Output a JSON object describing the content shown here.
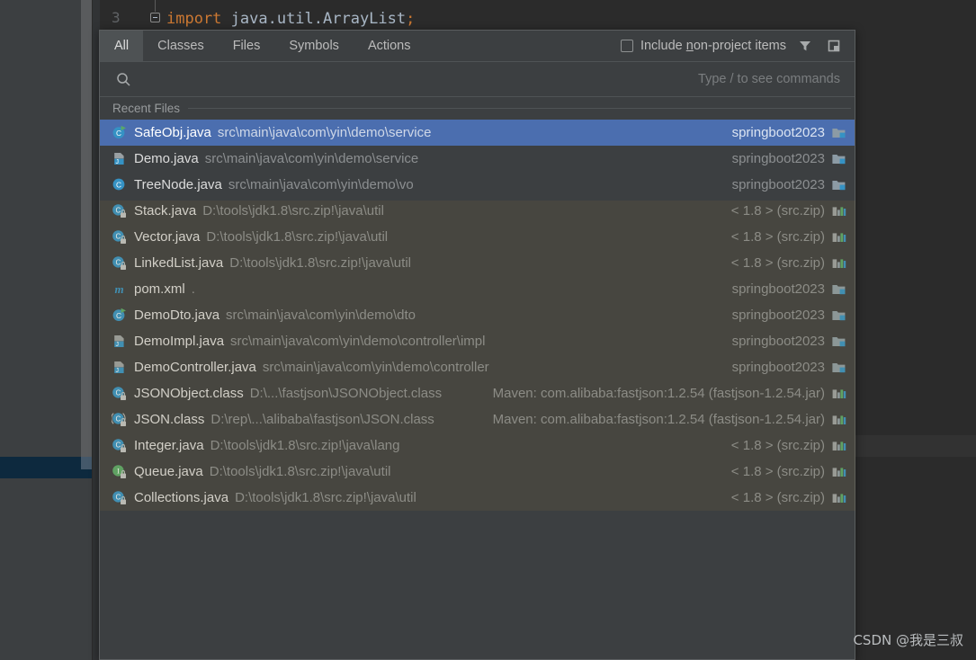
{
  "editor": {
    "line_number": "3",
    "keyword": "import",
    "expression": " java.util.ArrayList",
    "terminator": ";"
  },
  "popup": {
    "tabs": [
      {
        "label": "All",
        "active": true
      },
      {
        "label": "Classes",
        "active": false
      },
      {
        "label": "Files",
        "active": false
      },
      {
        "label": "Symbols",
        "active": false
      },
      {
        "label": "Actions",
        "active": false
      }
    ],
    "include_non_project": {
      "checked": false,
      "label_before": "Include ",
      "label_mnemonic": "n",
      "label_after": "on-project items"
    },
    "toolbar_icons": [
      {
        "name": "filter-icon"
      },
      {
        "name": "open-in-panel-icon"
      }
    ],
    "search": {
      "value": "",
      "placeholder": "",
      "hint": "Type / to see commands"
    },
    "group_header": "Recent Files",
    "rows": [
      {
        "icon": "java-class-runnable-icon",
        "name": "SafeObj.java",
        "path": "src\\main\\java\\com\\yin\\demo\\service",
        "module": "springboot2023",
        "module_icon": "module-folder-icon",
        "selected": true
      },
      {
        "icon": "java-file-icon",
        "name": "Demo.java",
        "path": "src\\main\\java\\com\\yin\\demo\\service",
        "module": "springboot2023",
        "module_icon": "module-folder-icon",
        "selected": false
      },
      {
        "icon": "java-class-icon",
        "name": "TreeNode.java",
        "path": "src\\main\\java\\com\\yin\\demo\\vo",
        "module": "springboot2023",
        "module_icon": "module-folder-icon",
        "selected": false
      },
      {
        "icon": "java-class-locked-icon",
        "name": "Stack.java",
        "path": "D:\\tools\\jdk1.8\\src.zip!\\java\\util",
        "module": "< 1.8 > (src.zip)",
        "module_icon": "library-icon",
        "selected": false
      },
      {
        "icon": "java-class-locked-icon",
        "name": "Vector.java",
        "path": "D:\\tools\\jdk1.8\\src.zip!\\java\\util",
        "module": "< 1.8 > (src.zip)",
        "module_icon": "library-icon",
        "selected": false
      },
      {
        "icon": "java-class-locked-icon",
        "name": "LinkedList.java",
        "path": "D:\\tools\\jdk1.8\\src.zip!\\java\\util",
        "module": "< 1.8 > (src.zip)",
        "module_icon": "library-icon",
        "selected": false
      },
      {
        "icon": "maven-icon",
        "name": "pom.xml",
        "path": ".",
        "module": "springboot2023",
        "module_icon": "module-folder-icon",
        "selected": false
      },
      {
        "icon": "java-class-runnable-icon",
        "name": "DemoDto.java",
        "path": "src\\main\\java\\com\\yin\\demo\\dto",
        "module": "springboot2023",
        "module_icon": "module-folder-icon",
        "selected": false
      },
      {
        "icon": "java-file-icon",
        "name": "DemoImpl.java",
        "path": "src\\main\\java\\com\\yin\\demo\\controller\\impl",
        "module": "springboot2023",
        "module_icon": "module-folder-icon",
        "selected": false
      },
      {
        "icon": "java-file-icon",
        "name": "DemoController.java",
        "path": "src\\main\\java\\com\\yin\\demo\\controller",
        "module": "springboot2023",
        "module_icon": "module-folder-icon",
        "selected": false
      },
      {
        "icon": "java-class-locked-icon",
        "name": "JSONObject.class",
        "path": "D:\\...\\fastjson\\JSONObject.class",
        "module": "Maven: com.alibaba:fastjson:1.2.54 (fastjson-1.2.54.jar)",
        "module_icon": "library-icon",
        "selected": false
      },
      {
        "icon": "java-class-abstract-locked-icon",
        "name": "JSON.class",
        "path": "D:\\rep\\...\\alibaba\\fastjson\\JSON.class",
        "module": "Maven: com.alibaba:fastjson:1.2.54 (fastjson-1.2.54.jar)",
        "module_icon": "library-icon",
        "selected": false
      },
      {
        "icon": "java-class-locked-icon",
        "name": "Integer.java",
        "path": "D:\\tools\\jdk1.8\\src.zip!\\java\\lang",
        "module": "< 1.8 > (src.zip)",
        "module_icon": "library-icon",
        "selected": false
      },
      {
        "icon": "java-interface-locked-icon",
        "name": "Queue.java",
        "path": "D:\\tools\\jdk1.8\\src.zip!\\java\\util",
        "module": "< 1.8 > (src.zip)",
        "module_icon": "library-icon",
        "selected": false
      },
      {
        "icon": "java-class-locked-icon",
        "name": "Collections.java",
        "path": "D:\\tools\\jdk1.8\\src.zip!\\java\\util",
        "module": "< 1.8 > (src.zip)",
        "module_icon": "library-icon",
        "selected": false
      }
    ]
  },
  "watermark": "CSDN @我是三叔",
  "colors": {
    "panel_bg": "#3c3f41",
    "editor_bg": "#2b2b2b",
    "selection_blue": "#4b6eaf",
    "keyword_orange": "#cc7832",
    "code_text": "#a9b7c6",
    "muted_text": "#8c8f91"
  }
}
